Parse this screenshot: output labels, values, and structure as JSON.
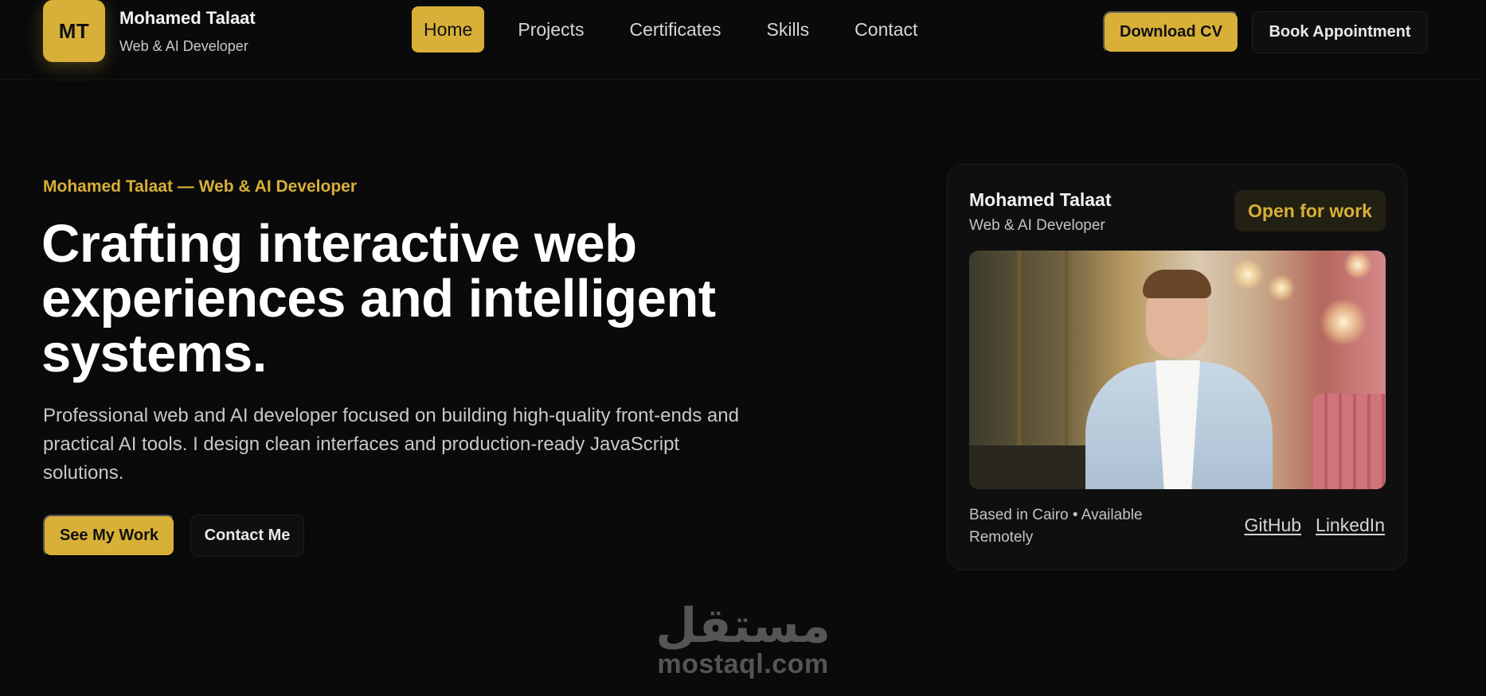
{
  "brand": {
    "initials": "MT",
    "name": "Mohamed Talaat",
    "role": "Web & AI Developer"
  },
  "nav": {
    "items": [
      {
        "label": "Home",
        "active": true
      },
      {
        "label": "Projects",
        "active": false
      },
      {
        "label": "Certificates",
        "active": false
      },
      {
        "label": "Skills",
        "active": false
      },
      {
        "label": "Contact",
        "active": false
      }
    ]
  },
  "header_actions": {
    "download_cv": "Download CV",
    "book_appointment": "Book Appointment"
  },
  "hero": {
    "eyebrow": "Mohamed Talaat — Web & AI Developer",
    "headline": "Crafting interactive web experiences and intelligent systems.",
    "lead": "Professional web and AI developer focused on building high-quality front-ends and practical AI tools. I design clean interfaces and production-ready JavaScript solutions.",
    "primary_cta": "See My Work",
    "secondary_cta": "Contact Me"
  },
  "card": {
    "name": "Mohamed Talaat",
    "role": "Web & AI Developer",
    "status_badge": "Open for work",
    "location": "Based in Cairo • Available Remotely",
    "links": [
      "GitHub",
      "LinkedIn"
    ]
  },
  "watermark": {
    "arabic": "مستقل",
    "latin": "mostaql.com"
  },
  "colors": {
    "background": "#0a0a0a",
    "accent": "#d8b038",
    "text": "#f2f2f2",
    "muted": "#c8c8c8"
  }
}
